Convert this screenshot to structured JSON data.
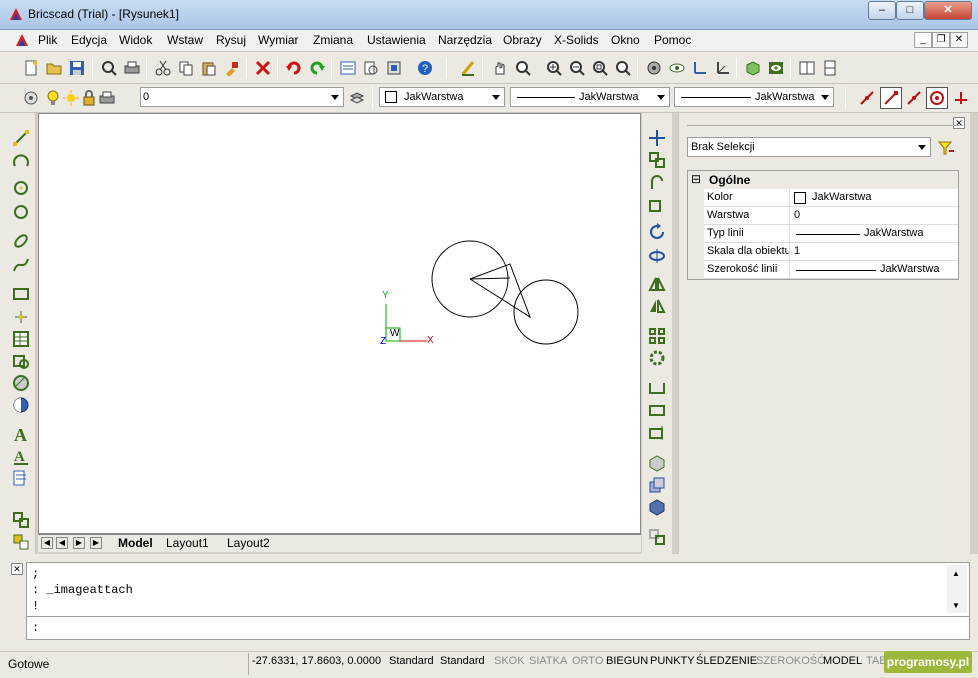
{
  "window": {
    "title": "Bricscad (Trial) - [Rysunek1]",
    "minimize": "‒",
    "maximize": "□",
    "close": "✕"
  },
  "menu": {
    "items": [
      "Plik",
      "Edycja",
      "Widok",
      "Wstaw",
      "Rysuj",
      "Wymiar",
      "Zmiana",
      "Ustawienia",
      "Narzędzia",
      "Obrazy",
      "X-Solids",
      "Okno",
      "Pomoc"
    ],
    "mdi_min": "_",
    "mdi_restore": "❐",
    "mdi_close": "✕"
  },
  "layer_toolbar": {
    "layer_value": "0",
    "color_value": "JakWarstwa",
    "linetype_value": "JakWarstwa",
    "lineweight_value": "JakWarstwa"
  },
  "colors": {
    "accent": "#1a55b4",
    "drawing_line": "#000000",
    "axis_x": "#cc0000",
    "axis_y": "#00aa00",
    "toolbar_icon": "#3c6e1e"
  },
  "canvas": {
    "ucs_x": "X",
    "ucs_y": "Y",
    "ucs_z": "Z",
    "ucs_w": "W"
  },
  "tabs": {
    "model": "Model",
    "layout1": "Layout1",
    "layout2": "Layout2"
  },
  "properties": {
    "selection": "Brak Selekcji",
    "section": "Ogólne",
    "rows": [
      {
        "key": "Kolor",
        "value": "JakWarstwa"
      },
      {
        "key": "Warstwa",
        "value": "0"
      },
      {
        "key": "Typ linii",
        "value": "JakWarstwa"
      },
      {
        "key": "Skala dla obiektu",
        "value": "1"
      },
      {
        "key": "Szerokość linii",
        "value": "JakWarstwa"
      }
    ],
    "collapse": "⊟",
    "close": "✕"
  },
  "command": {
    "line1": ";",
    "line2": ": _imageattach",
    "line3": "!",
    "prompt": ":",
    "close": "✕"
  },
  "status": {
    "ready": "Gotowe",
    "coords": "-27.6331, 17.8603, 0.0000",
    "style1": "Standard",
    "style2": "Standard",
    "toggles": [
      {
        "label": "SKOK",
        "on": false
      },
      {
        "label": "SIATKA",
        "on": false
      },
      {
        "label": "ORTO",
        "on": false
      },
      {
        "label": "BIEGUN",
        "on": true
      },
      {
        "label": "PUNKTY",
        "on": true
      },
      {
        "label": "ŚLEDZENIE",
        "on": true
      },
      {
        "label": "SZEROKOŚĆ",
        "on": false
      },
      {
        "label": "MODEL",
        "on": true
      },
      {
        "label": "TAB",
        "on": false
      }
    ],
    "watermark": "programosy.pl"
  }
}
